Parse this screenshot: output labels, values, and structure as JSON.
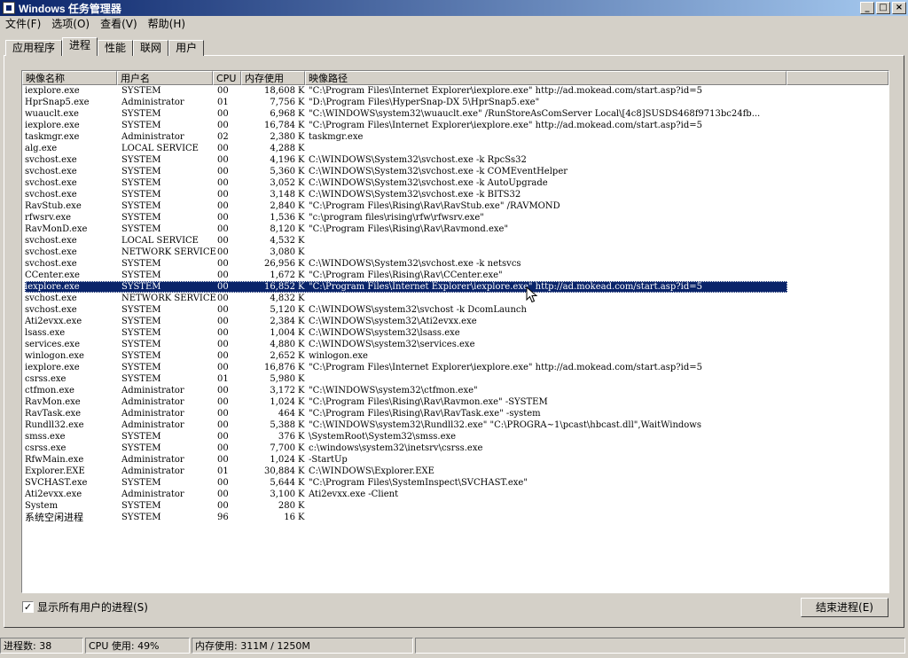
{
  "window": {
    "title": "Windows 任务管理器",
    "buttons": [
      "_",
      "□",
      "×"
    ]
  },
  "menu": [
    {
      "label": "文件(F)"
    },
    {
      "label": "选项(O)"
    },
    {
      "label": "查看(V)"
    },
    {
      "label": "帮助(H)"
    }
  ],
  "tabs": [
    {
      "label": "应用程序"
    },
    {
      "label": "进程"
    },
    {
      "label": "性能"
    },
    {
      "label": "联网"
    },
    {
      "label": "用户"
    }
  ],
  "active_tab": "进程",
  "columns": [
    "映像名称",
    "用户名",
    "CPU",
    "内存使用",
    "映像路径",
    ""
  ],
  "processes": [
    [
      "iexplore.exe",
      "SYSTEM",
      "00",
      "18,608",
      "K",
      "\"C:\\Program Files\\Internet Explorer\\iexplore.exe\" http://ad.mokead.com/start.asp?id=5"
    ],
    [
      "HprSnap5.exe",
      "Administrator",
      "01",
      "7,756",
      "K",
      "\"D:\\Program Files\\HyperSnap-DX 5\\HprSnap5.exe\""
    ],
    [
      "wuauclt.exe",
      "SYSTEM",
      "00",
      "6,968",
      "K",
      "\"C:\\WINDOWS\\system32\\wuauclt.exe\" /RunStoreAsComServer Local\\[4c8]SUSDS468f9713bc24fb..."
    ],
    [
      "iexplore.exe",
      "SYSTEM",
      "00",
      "16,784",
      "K",
      "\"C:\\Program Files\\Internet Explorer\\iexplore.exe\" http://ad.mokead.com/start.asp?id=5"
    ],
    [
      "taskmgr.exe",
      "Administrator",
      "02",
      "2,380",
      "K",
      "taskmgr.exe"
    ],
    [
      "alg.exe",
      "LOCAL SERVICE",
      "00",
      "4,288",
      "K",
      ""
    ],
    [
      "svchost.exe",
      "SYSTEM",
      "00",
      "4,196",
      "K",
      "C:\\WINDOWS\\System32\\svchost.exe -k RpcSs32"
    ],
    [
      "svchost.exe",
      "SYSTEM",
      "00",
      "5,360",
      "K",
      "C:\\WINDOWS\\System32\\svchost.exe -k COMEventHelper"
    ],
    [
      "svchost.exe",
      "SYSTEM",
      "00",
      "3,052",
      "K",
      "C:\\WINDOWS\\System32\\svchost.exe -k AutoUpgrade"
    ],
    [
      "svchost.exe",
      "SYSTEM",
      "00",
      "3,148",
      "K",
      "C:\\WINDOWS\\System32\\svchost.exe -k BITS32"
    ],
    [
      "RavStub.exe",
      "SYSTEM",
      "00",
      "2,840",
      "K",
      "\"C:\\Program Files\\Rising\\Rav\\RavStub.exe\" /RAVMOND"
    ],
    [
      "rfwsrv.exe",
      "SYSTEM",
      "00",
      "1,536",
      "K",
      "\"c:\\program files\\rising\\rfw\\rfwsrv.exe\""
    ],
    [
      "RavMonD.exe",
      "SYSTEM",
      "00",
      "8,120",
      "K",
      "\"C:\\Program Files\\Rising\\Rav\\Ravmond.exe\""
    ],
    [
      "svchost.exe",
      "LOCAL SERVICE",
      "00",
      "4,532",
      "K",
      ""
    ],
    [
      "svchost.exe",
      "NETWORK SERVICE",
      "00",
      "3,080",
      "K",
      ""
    ],
    [
      "svchost.exe",
      "SYSTEM",
      "00",
      "26,956",
      "K",
      "C:\\WINDOWS\\System32\\svchost.exe -k netsvcs"
    ],
    [
      "CCenter.exe",
      "SYSTEM",
      "00",
      "1,672",
      "K",
      "\"C:\\Program Files\\Rising\\Rav\\CCenter.exe\""
    ],
    [
      "iexplore.exe",
      "SYSTEM",
      "00",
      "16,852",
      "K",
      "\"C:\\Program Files\\Internet Explorer\\iexplore.exe\" http://ad.mokead.com/start.asp?id=5"
    ],
    [
      "svchost.exe",
      "NETWORK SERVICE",
      "00",
      "4,832",
      "K",
      ""
    ],
    [
      "svchost.exe",
      "SYSTEM",
      "00",
      "5,120",
      "K",
      "C:\\WINDOWS\\system32\\svchost -k DcomLaunch"
    ],
    [
      "Ati2evxx.exe",
      "SYSTEM",
      "00",
      "2,384",
      "K",
      "C:\\WINDOWS\\system32\\Ati2evxx.exe"
    ],
    [
      "lsass.exe",
      "SYSTEM",
      "00",
      "1,004",
      "K",
      "C:\\WINDOWS\\system32\\lsass.exe"
    ],
    [
      "services.exe",
      "SYSTEM",
      "00",
      "4,880",
      "K",
      "C:\\WINDOWS\\system32\\services.exe"
    ],
    [
      "winlogon.exe",
      "SYSTEM",
      "00",
      "2,652",
      "K",
      "winlogon.exe"
    ],
    [
      "iexplore.exe",
      "SYSTEM",
      "00",
      "16,876",
      "K",
      "\"C:\\Program Files\\Internet Explorer\\iexplore.exe\" http://ad.mokead.com/start.asp?id=5"
    ],
    [
      "csrss.exe",
      "SYSTEM",
      "01",
      "5,980",
      "K",
      ""
    ],
    [
      "ctfmon.exe",
      "Administrator",
      "00",
      "3,172",
      "K",
      "\"C:\\WINDOWS\\system32\\ctfmon.exe\""
    ],
    [
      "RavMon.exe",
      "Administrator",
      "00",
      "1,024",
      "K",
      "\"C:\\Program Files\\Rising\\Rav\\Ravmon.exe\" -SYSTEM"
    ],
    [
      "RavTask.exe",
      "Administrator",
      "00",
      "464",
      "K",
      "\"C:\\Program Files\\Rising\\Rav\\RavTask.exe\" -system"
    ],
    [
      "Rundll32.exe",
      "Administrator",
      "00",
      "5,388",
      "K",
      "\"C:\\WINDOWS\\system32\\Rundll32.exe\"  \"C:\\PROGRA~1\\pcast\\hbcast.dll\",WaitWindows"
    ],
    [
      "smss.exe",
      "SYSTEM",
      "00",
      "376",
      "K",
      "\\SystemRoot\\System32\\smss.exe"
    ],
    [
      "csrss.exe",
      "SYSTEM",
      "00",
      "7,700",
      "K",
      "c:\\windows\\system32\\inetsrv\\csrss.exe"
    ],
    [
      "RfwMain.exe",
      "Administrator",
      "00",
      "1,024",
      "K",
      " -StartUp"
    ],
    [
      "Explorer.EXE",
      "Administrator",
      "01",
      "30,884",
      "K",
      "C:\\WINDOWS\\Explorer.EXE"
    ],
    [
      "SVCHAST.exe",
      "SYSTEM",
      "00",
      "5,644",
      "K",
      "\"C:\\Program Files\\SystemInspect\\SVCHAST.exe\""
    ],
    [
      "Ati2evxx.exe",
      "Administrator",
      "00",
      "3,100",
      "K",
      "Ati2evxx.exe -Client"
    ],
    [
      "System",
      "SYSTEM",
      "00",
      "280",
      "K",
      ""
    ],
    [
      "系统空闲进程",
      "SYSTEM",
      "96",
      "16",
      "K",
      ""
    ]
  ],
  "selected_index": 17,
  "show_all_users": {
    "label": "显示所有用户的进程(S)",
    "checked": true,
    "mark": "✓"
  },
  "end_process_button": "结束进程(E)",
  "status": {
    "process_count": "进程数: 38",
    "cpu_usage": "CPU 使用: 49%",
    "memory_usage": "内存使用: 311M / 1250M"
  }
}
